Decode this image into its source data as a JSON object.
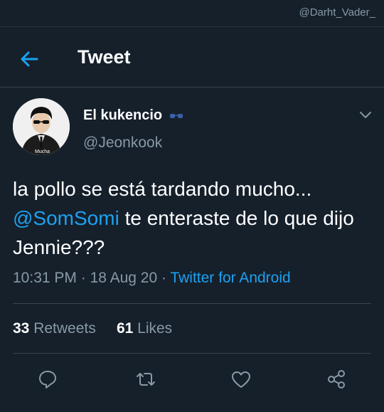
{
  "watermark": "@Darht_Vader_",
  "header": {
    "title": "Tweet"
  },
  "tweet": {
    "display_name": "El kukencio",
    "handle": "@Jeonkook",
    "avatar_caption": "Mucha",
    "text_before": "la pollo se está tardando mucho...",
    "mention": "@SomSomi",
    "text_after": " te enteraste de lo que dijo Jennie???",
    "time": "10:31 PM",
    "dot": " · ",
    "date": "18 Aug 20",
    "source": "Twitter for Android",
    "retweets_count": "33",
    "retweets_label": "Retweets",
    "likes_count": "61",
    "likes_label": "Likes"
  },
  "colors": {
    "background": "#15202b",
    "accent": "#1da1f2",
    "secondary_text": "#8899a6",
    "divider": "#38444d"
  },
  "icons": {
    "back": "arrow-left-icon",
    "more": "chevron-down-icon",
    "reply": "reply-icon",
    "retweet": "retweet-icon",
    "like": "heart-icon",
    "share": "share-icon",
    "emoji": "sunglasses-emoji-icon"
  }
}
